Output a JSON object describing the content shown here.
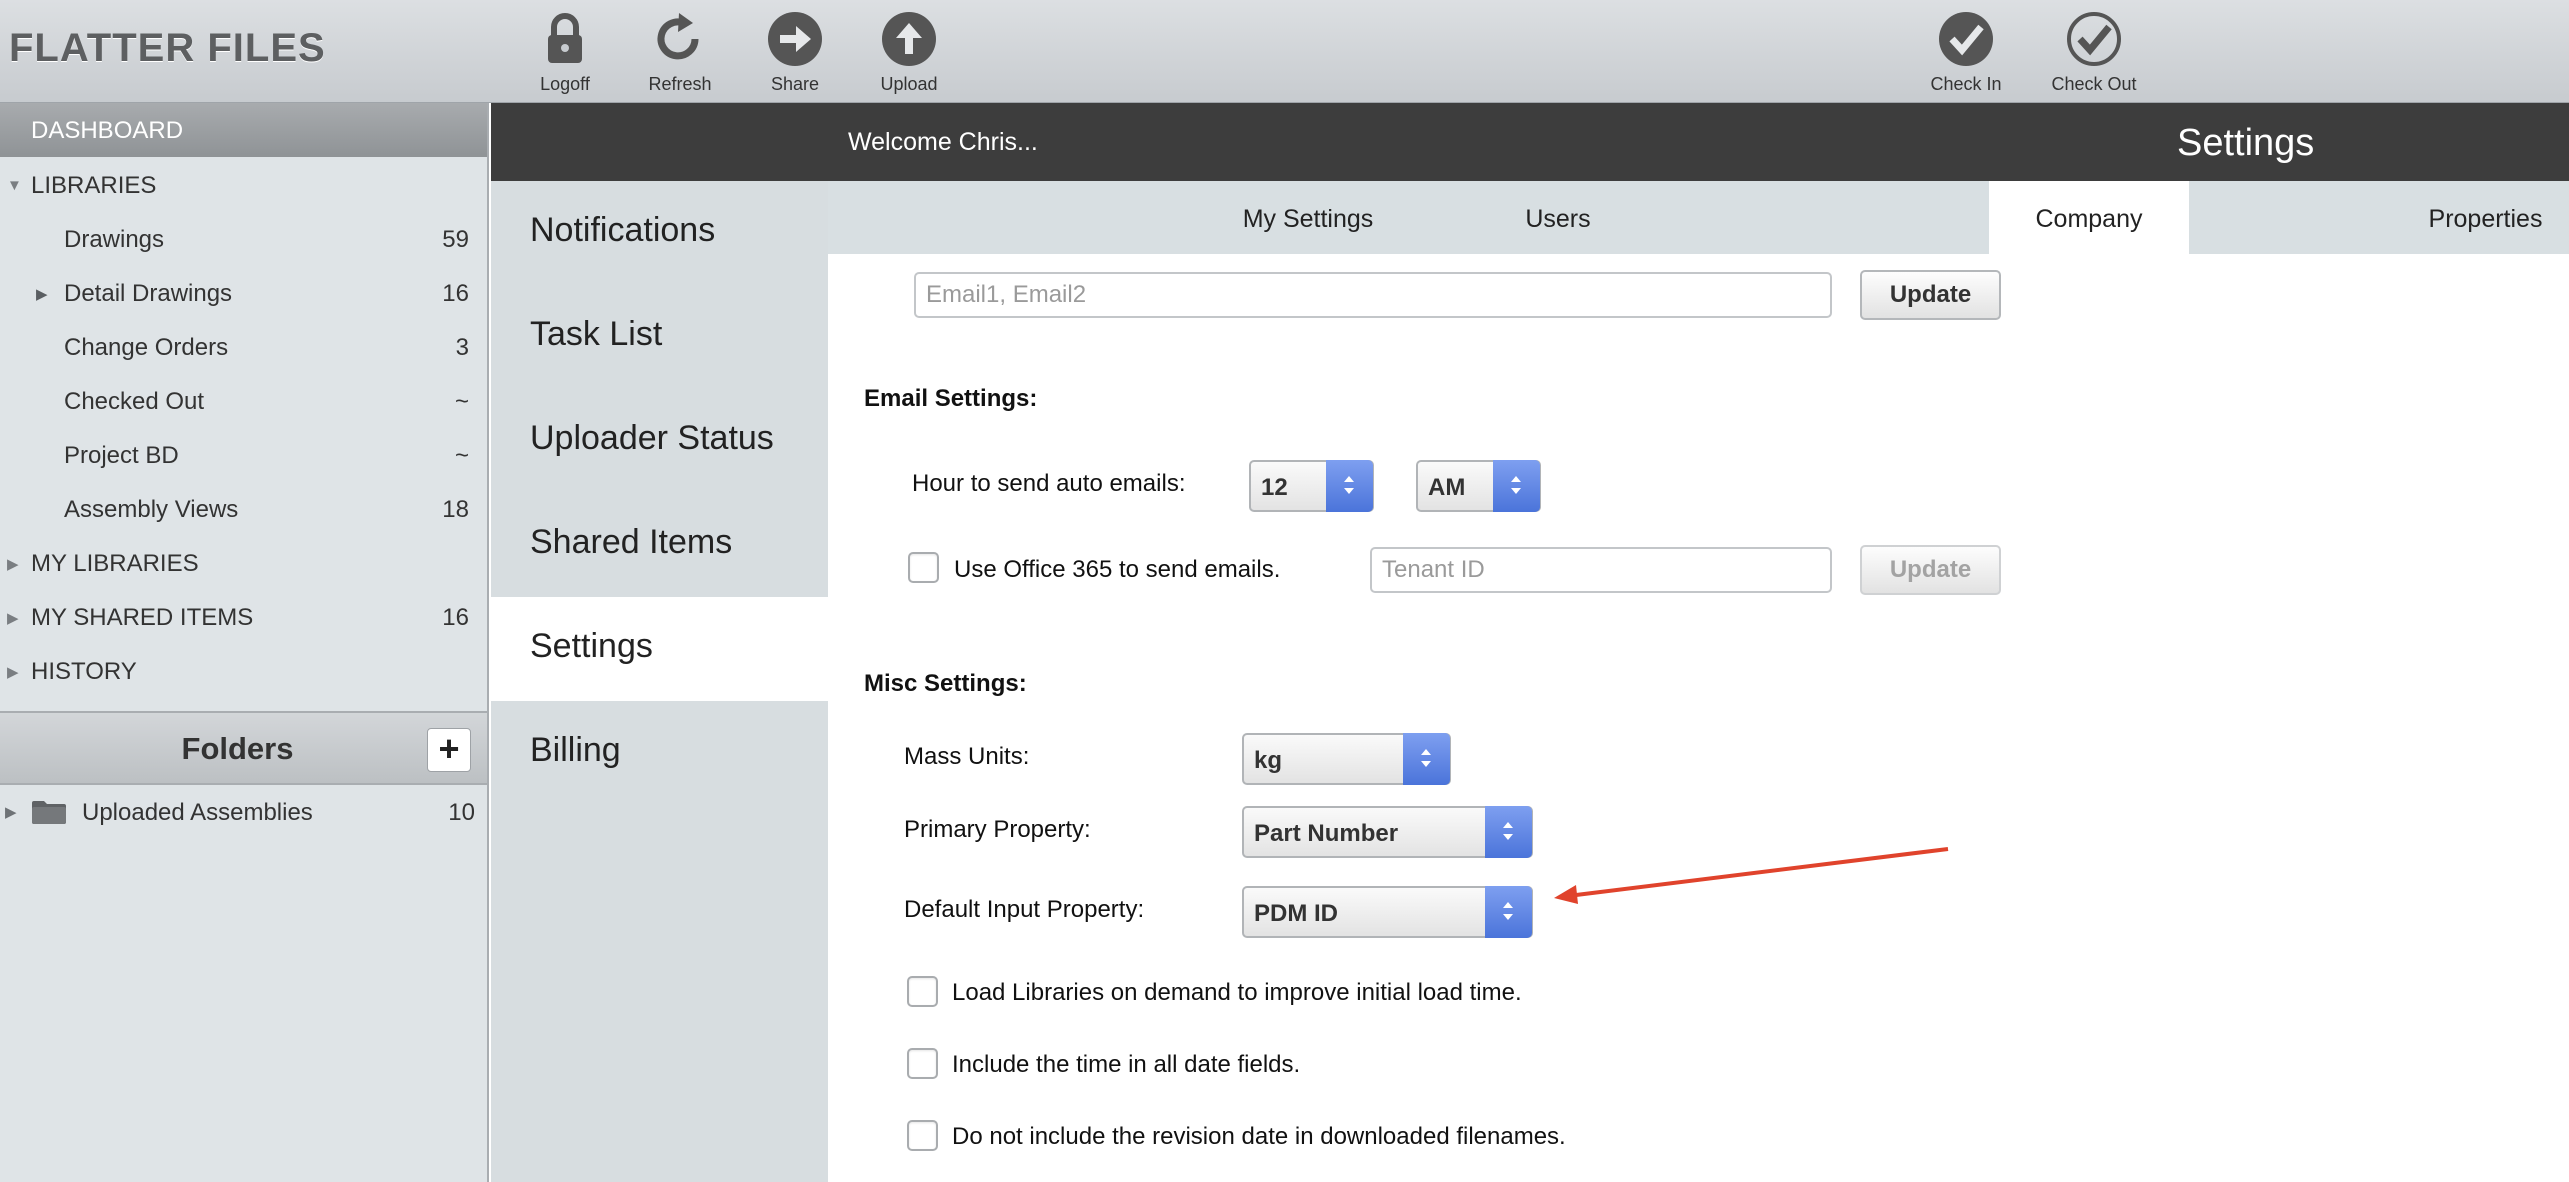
{
  "app": {
    "title": "FLATTER FILES"
  },
  "toolbar": {
    "logoff": "Logoff",
    "refresh": "Refresh",
    "share": "Share",
    "upload": "Upload",
    "check_in": "Check In",
    "check_out": "Check Out"
  },
  "sidebar": {
    "dashboard": "DASHBOARD",
    "libraries_label": "LIBRARIES",
    "libraries": [
      {
        "label": "Drawings",
        "count": "59"
      },
      {
        "label": "Detail Drawings",
        "count": "16"
      },
      {
        "label": "Change Orders",
        "count": "3"
      },
      {
        "label": "Checked Out",
        "count": "~"
      },
      {
        "label": "Project BD",
        "count": "~"
      },
      {
        "label": "Assembly Views",
        "count": "18"
      }
    ],
    "my_libraries": "MY LIBRARIES",
    "my_shared_items": {
      "label": "MY SHARED ITEMS",
      "count": "16"
    },
    "history": "HISTORY",
    "folders_title": "Folders",
    "add_folder": "+",
    "folders": [
      {
        "label": "Uploaded Assemblies",
        "count": "10"
      }
    ]
  },
  "nav": {
    "items": [
      "Notifications",
      "Task List",
      "Uploader Status",
      "Shared Items",
      "Settings",
      "Billing"
    ],
    "active": "Settings"
  },
  "header": {
    "welcome": "Welcome Chris...",
    "title": "Settings"
  },
  "tabs": {
    "items": [
      "My Settings",
      "Users",
      "Company",
      "Properties"
    ],
    "active": "Company"
  },
  "emails": {
    "placeholder": "Email1, Email2",
    "value": "",
    "update_label": "Update"
  },
  "email_settings": {
    "title": "Email Settings:",
    "hour_label": "Hour to send auto emails:",
    "hour_value": "12",
    "ampm_value": "AM",
    "office365_label": "Use Office 365 to send emails.",
    "office365_checked": false,
    "tenant_placeholder": "Tenant ID",
    "tenant_update_label": "Update"
  },
  "misc_settings": {
    "title": "Misc Settings:",
    "mass_units_label": "Mass Units:",
    "mass_units_value": "kg",
    "primary_property_label": "Primary Property:",
    "primary_property_value": "Part Number",
    "default_input_label": "Default Input Property:",
    "default_input_value": "PDM ID",
    "checkboxes": [
      {
        "label": "Load Libraries on demand to improve initial load time.",
        "checked": false
      },
      {
        "label": "Include the time in all date fields.",
        "checked": false
      },
      {
        "label": "Do not include the revision date in downloaded filenames.",
        "checked": false
      }
    ]
  },
  "colors": {
    "accent_blue": "#5a80e0",
    "header_dark": "#3d3d3d",
    "annotation_arrow": "#e0432c"
  }
}
